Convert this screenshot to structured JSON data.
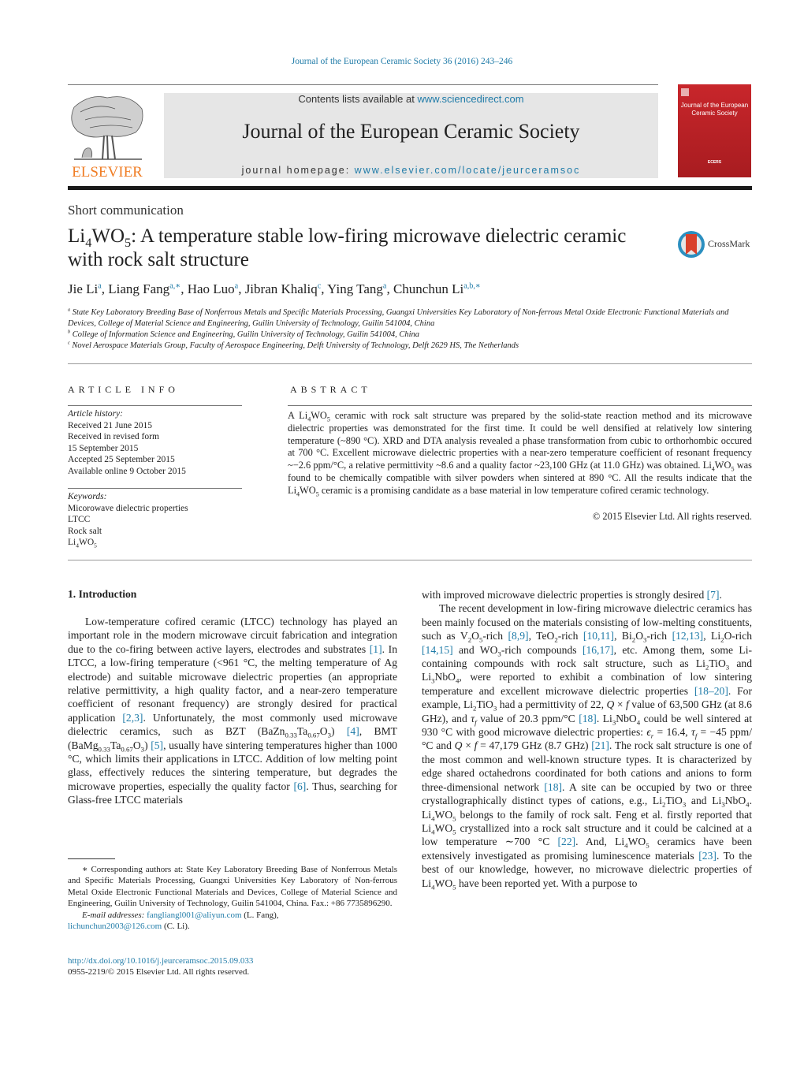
{
  "header": {
    "journal_ref": "Journal of the European Ceramic Society 36 (2016) 243–246",
    "contents_prefix": "Contents lists available at ",
    "contents_link": "www.sciencedirect.com",
    "journal_title": "Journal of the European Ceramic Society",
    "homepage_prefix": "journal homepage: ",
    "homepage_link": "www.elsevier.com/locate/jeurceramsoc",
    "publisher_logo": "ELSEVIER",
    "cover_title": "Journal of the European Ceramic Society",
    "cover_mark": "ECERS",
    "crossmark_label": "CrossMark"
  },
  "article": {
    "type": "Short communication",
    "title_formula": {
      "base": "Li",
      "s1": "4",
      "mid": "WO",
      "s2": "5"
    },
    "title_rest": ": A temperature stable low-firing microwave dielectric ceramic with rock salt structure",
    "authors": [
      {
        "name": "Jie Li",
        "sup": "a"
      },
      {
        "name": "Liang Fang",
        "sup": "a,∗"
      },
      {
        "name": "Hao Luo",
        "sup": "a"
      },
      {
        "name": "Jibran Khaliq",
        "sup": "c"
      },
      {
        "name": "Ying Tang",
        "sup": "a"
      },
      {
        "name": "Chunchun Li",
        "sup": "a,b,∗"
      }
    ],
    "affiliations": [
      {
        "key": "a",
        "text": "State Key Laboratory Breeding Base of Nonferrous Metals and Specific Materials Processing, Guangxi Universities Key Laboratory of Non-ferrous Metal Oxide Electronic Functional Materials and Devices, College of Material Science and Engineering, Guilin University of Technology, Guilin 541004, China"
      },
      {
        "key": "b",
        "text": "College of Information Science and Engineering, Guilin University of Technology, Guilin 541004, China"
      },
      {
        "key": "c",
        "text": "Novel Aerospace Materials Group, Faculty of Aerospace Engineering, Delft University of Technology, Delft 2629 HS, The Netherlands"
      }
    ]
  },
  "article_info": {
    "heading": "ARTICLE INFO",
    "history_label": "Article history:",
    "history": [
      "Received 21 June 2015",
      "Received in revised form",
      "15 September 2015",
      "Accepted 25 September 2015",
      "Available online 9 October 2015"
    ],
    "keywords_label": "Keywords:",
    "keywords": [
      "Micorowave dielectric properties",
      "LTCC",
      "Rock salt"
    ],
    "keyword_formula": "Li4WO5"
  },
  "abstract": {
    "heading": "ABSTRACT",
    "p1": "ceramic with rock salt structure was prepared by the solid-state reaction method and its microwave dielectric properties was demonstrated for the first time. It could be well densified at relatively low sintering temperature (~890 °C). XRD and DTA analysis revealed a phase transformation from cubic to orthorhombic occured at 700 °C. Excellent microwave dielectric properties with a near-zero temperature coefficient of resonant frequency ~−2.6 ppm/°C, a relative permittivity ~8.6 and a quality factor ~23,100 GHz (at 11.0 GHz) was obtained.",
    "p2": "was found to be chemically compatible with silver powders when sintered at 890 °C. All the results indicate that the",
    "p3": "ceramic is a promising candidate as a base material in low temperature cofired ceramic technology.",
    "copyright": "© 2015 Elsevier Ltd. All rights reserved."
  },
  "intro": {
    "heading": "1.  Introduction",
    "left": [
      "Low-temperature cofired ceramic (LTCC) technology has played an important role in the modern microwave circuit fabrication and integration due to the co-firing between active layers, electrodes and substrates",
      "[1]",
      ". In LTCC, a low-firing temperature (<961 °C, the melting temperature of Ag electrode) and suitable microwave dielectric properties (an appropriate relative permittivity, a high quality factor, and a near-zero temperature coefficient of resonant frequency) are strongly desired for practical application",
      "[2,3]",
      ". Unfortunately, the most commonly used microwave dielectric ceramics, such as BZT (BaZn",
      "[4]",
      "[5]",
      ", usually have sintering temperatures higher than 1000 °C, which limits their applications in LTCC. Addition of low melting point glass, effectively reduces the sintering temperature, but degrades the microwave properties, especially the quality factor",
      "[6]",
      ". Thus, searching for Glass-free LTCC materials"
    ],
    "right_p1": "with improved microwave dielectric properties is strongly desired",
    "right_ref7": "[7]",
    "right_p2_refs": [
      "[8,9]",
      "[10,11]",
      "[12,13]",
      "[14,15]",
      "[16,17]",
      "[18–20]",
      "[18]",
      "[21]",
      "[18]",
      "[22]",
      "[23]"
    ]
  },
  "footnote": {
    "text": "∗ Corresponding authors at: State Key Laboratory Breeding Base of Nonferrous Metals and Specific Materials Processing, Guangxi Universities Key Laboratory of Non-ferrous Metal Oxide Electronic Functional Materials and Devices, College of Material Science and Engineering, Guilin University of Technology, Guilin 541004, China. Fax.: +86 7735896290.",
    "email_label": "E-mail addresses:",
    "email1": "fangliangl001@aliyun.com",
    "email1_name": " (L. Fang),",
    "email2": "lichunchun2003@126.com",
    "email2_name": " (C. Li).",
    "doi": "http://dx.doi.org/10.1016/j.jeurceramsoc.2015.09.033",
    "issn": "0955-2219/© 2015 Elsevier Ltd. All rights reserved."
  },
  "colors": {
    "link": "#1f7ba8",
    "elsevier_orange": "#f07e26",
    "cover_red": "#c8262b"
  }
}
